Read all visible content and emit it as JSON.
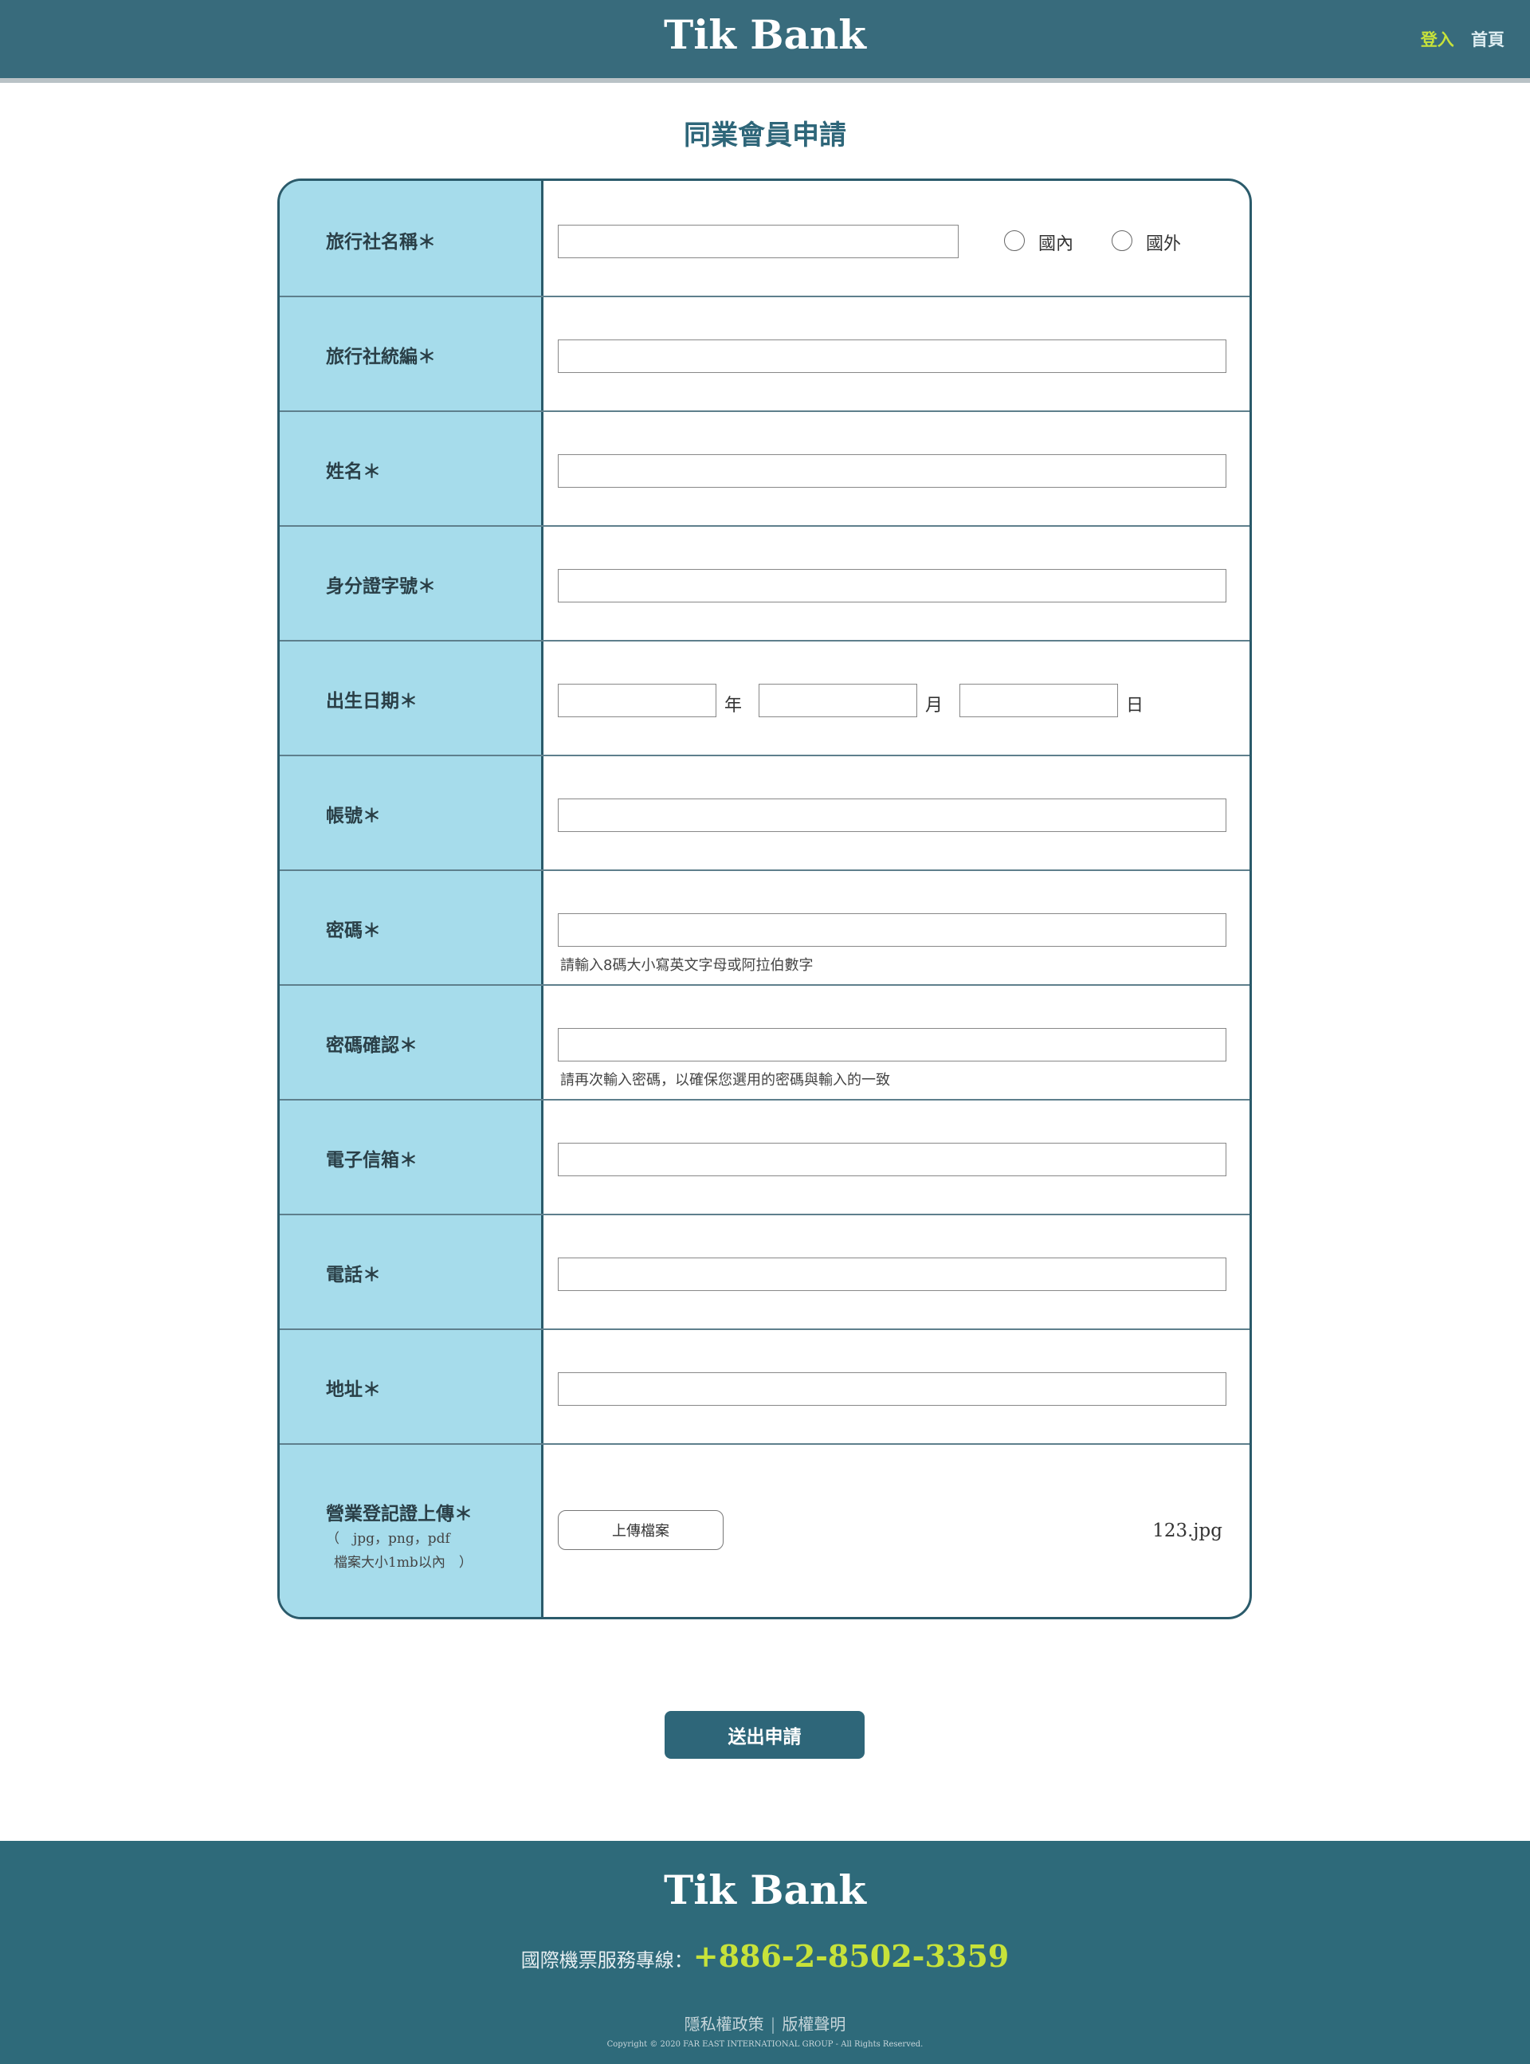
{
  "header": {
    "brand": "Tik Bank",
    "nav": {
      "login": "登入",
      "home": "首頁"
    }
  },
  "page_title": "同業會員申請",
  "form": {
    "agency_name": {
      "label": "旅行社名稱＊",
      "radio_domestic": "國內",
      "radio_foreign": "國外"
    },
    "agency_tax_id": {
      "label": "旅行社統編＊"
    },
    "name": {
      "label": "姓名＊"
    },
    "id_number": {
      "label": "身分證字號＊"
    },
    "birthday": {
      "label": "出生日期＊",
      "year_unit": "年",
      "month_unit": "月",
      "day_unit": "日"
    },
    "account": {
      "label": "帳號＊"
    },
    "password": {
      "label": "密碼＊",
      "hint": "請輸入8碼大小寫英文字母或阿拉伯數字"
    },
    "password_confirm": {
      "label": "密碼確認＊",
      "hint": "請再次輸入密碼，以確保您選用的密碼與輸入的一致"
    },
    "email": {
      "label": "電子信箱＊"
    },
    "phone": {
      "label": "電話＊"
    },
    "address": {
      "label": "地址＊"
    },
    "upload": {
      "label": "營業登記證上傳＊",
      "note_formats": "（　jpg，png，pdf",
      "note_size": "檔案大小1mb以內　）",
      "button": "上傳檔案",
      "file_name": "123.jpg"
    }
  },
  "submit_label": "送出申請",
  "footer": {
    "brand": "Tik Bank",
    "hotline_label": "國際機票服務專線：",
    "hotline_number": "+886-2-8502-3359",
    "privacy": "隱私權政策",
    "separator": "|",
    "copyright_statement": "版權聲明",
    "copyright": "Copyright © 2020 FAR EAST INTERNATIONAL GROUP - All Rights Reserved."
  },
  "colors": {
    "header_bg": "#386b7c",
    "label_bg": "#a6dceb",
    "accent": "#c7e23a",
    "title": "#2e6679",
    "footer_bg": "#2e6a7a"
  }
}
